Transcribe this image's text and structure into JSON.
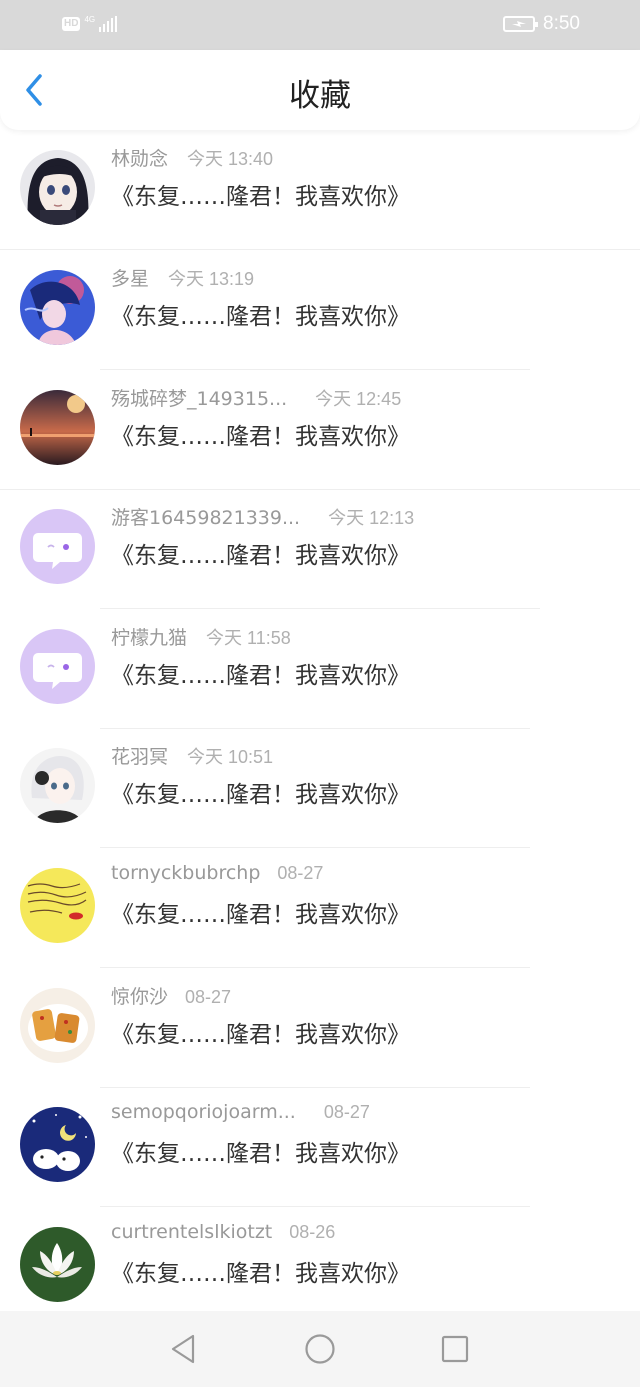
{
  "status_bar": {
    "network_hd": "HD",
    "network_type": "4G",
    "time": "8:50"
  },
  "header": {
    "title": "收藏",
    "back_icon": "chevron-left-icon",
    "accent_color": "#2f8fe6"
  },
  "items": [
    {
      "username": "林勋念",
      "time": "今天 13:40",
      "message": "《东复……隆君！我喜欢你》",
      "avatar": "anime-girl"
    },
    {
      "username": "多星",
      "time": "今天 13:19",
      "message": "《东复……隆君！我喜欢你》",
      "avatar": "blue-illustration"
    },
    {
      "username": "殇城碎梦_149315...",
      "time": "今天 12:45",
      "message": "《东复……隆君！我喜欢你》",
      "avatar": "sunset-moon"
    },
    {
      "username": "游客16459821339...",
      "time": "今天 12:13",
      "message": "《东复……隆君！我喜欢你》",
      "avatar": "default-chat-bubble"
    },
    {
      "username": "柠檬九猫",
      "time": "今天 11:58",
      "message": "《东复……隆君！我喜欢你》",
      "avatar": "default-chat-bubble"
    },
    {
      "username": "花羽冥",
      "time": "今天 10:51",
      "message": "《东复……隆君！我喜欢你》",
      "avatar": "anime-white-hair"
    },
    {
      "username": "tornyckbubrchp",
      "time": "08-27",
      "message": "《东复……隆君！我喜欢你》",
      "avatar": "yellow-note"
    },
    {
      "username": "惊你沙",
      "time": "08-27",
      "message": "《东复……隆君！我喜欢你》",
      "avatar": "food-toast"
    },
    {
      "username": "semopqoriojoarm...",
      "time": "08-27",
      "message": "《东复……隆君！我喜欢你》",
      "avatar": "night-sky-cartoon"
    },
    {
      "username": "curtrentelslkiotzt",
      "time": "08-26",
      "message": "《东复……隆君！我喜欢你》",
      "avatar": "white-lotus"
    }
  ],
  "system_nav": {
    "back": "triangle-back-icon",
    "home": "circle-home-icon",
    "recents": "square-recents-icon"
  }
}
